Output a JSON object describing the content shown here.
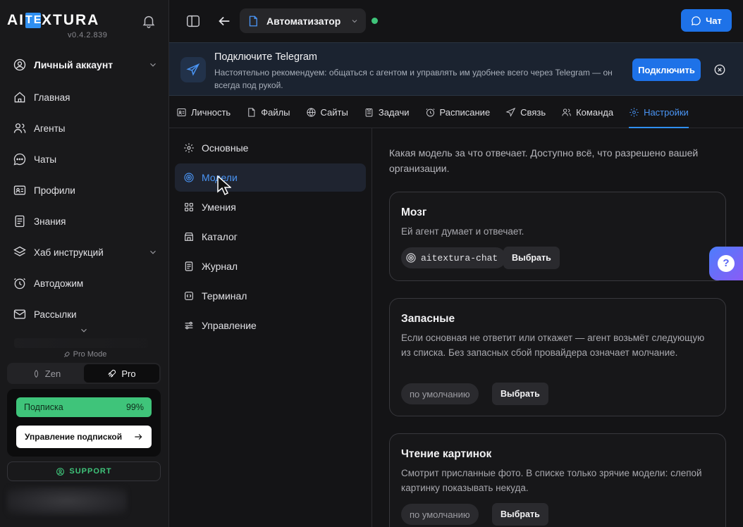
{
  "sidebar": {
    "logo": {
      "pre": "AI",
      "mark": "TE",
      "post": "XTURA"
    },
    "version": "v0.4.2.839",
    "account": "Личный аккаунт",
    "items": [
      {
        "label": "Главная",
        "icon": "home-icon"
      },
      {
        "label": "Агенты",
        "icon": "agents-icon"
      },
      {
        "label": "Чаты",
        "icon": "chat-icon"
      },
      {
        "label": "Профили",
        "icon": "profile-icon"
      },
      {
        "label": "Знания",
        "icon": "knowledge-icon"
      },
      {
        "label": "Хаб инструкций",
        "icon": "hub-icon"
      },
      {
        "label": "Автодожим",
        "icon": "clock-icon"
      },
      {
        "label": "Рассылки",
        "icon": "mail-icon"
      }
    ],
    "pro_mode": "Pro Mode",
    "modes": [
      "Zen",
      "Pro"
    ],
    "subscription": {
      "label": "Подписка",
      "percent": "99%",
      "manage": "Управление подпиской"
    },
    "support": "SUPPORT"
  },
  "topbar": {
    "agent": "Автоматизатор",
    "chat": "Чат"
  },
  "banner": {
    "title": "Подключите Telegram",
    "text": "Настоятельно рекомендуем: общаться с агентом и управлять им удобнее всего через Telegram — он всегда под рукой.",
    "button": "Подключить"
  },
  "tabs": [
    "Личность",
    "Файлы",
    "Сайты",
    "Задачи",
    "Расписание",
    "Связь",
    "Команда",
    "Настройки"
  ],
  "settings": [
    "Основные",
    "Модели",
    "Умения",
    "Каталог",
    "Журнал",
    "Терминал",
    "Управление"
  ],
  "content": {
    "intro": "Какая модель за что отвечает. Доступно всё, что разрешено вашей организации.",
    "cards": [
      {
        "title": "Мозг",
        "desc": "Ей агент думает и отвечает.",
        "chip": "aitextura-chat",
        "button": "Выбрать"
      },
      {
        "title": "Запасные",
        "desc": "Если основная не ответит или откажет — агент возьмёт следующую из списка. Без запасных сбой провайдера означает молчание.",
        "chip": "по умолчанию",
        "button": "Выбрать"
      },
      {
        "title": "Чтение картинок",
        "desc": "Смотрит присланные фото. В списке только зрячие модели: слепой картинку показывать некуда.",
        "chip": "по умолчанию",
        "button": "Выбрать"
      }
    ]
  },
  "colors": {
    "accent": "#1e72e8",
    "success": "#3fc47a",
    "background": "#141416"
  }
}
